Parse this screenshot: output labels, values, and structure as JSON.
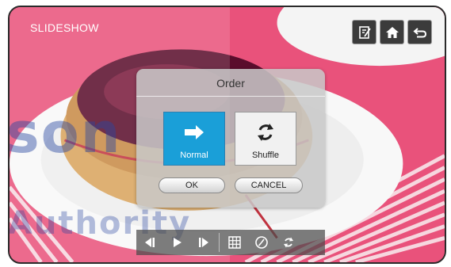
{
  "app": {
    "title": "SLIDESHOW"
  },
  "watermark": {
    "line1": "son",
    "line2": "Authority"
  },
  "top_buttons": [
    {
      "icon": "edit-note-icon"
    },
    {
      "icon": "home-icon"
    },
    {
      "icon": "back-icon"
    }
  ],
  "dialog": {
    "title": "Order",
    "options": [
      {
        "label": "Normal",
        "icon": "arrow-right-icon",
        "selected": true
      },
      {
        "label": "Shuffle",
        "icon": "shuffle-icon",
        "selected": false
      }
    ],
    "ok_label": "OK",
    "cancel_label": "CANCEL"
  },
  "toolbar": [
    {
      "icon": "previous-icon"
    },
    {
      "icon": "play-icon"
    },
    {
      "icon": "next-icon"
    },
    {
      "icon": "grid-icon"
    },
    {
      "icon": "timer-icon"
    },
    {
      "icon": "shuffle-icon"
    }
  ],
  "colors": {
    "accent": "#1a9fd8",
    "background": "#e84a74"
  }
}
